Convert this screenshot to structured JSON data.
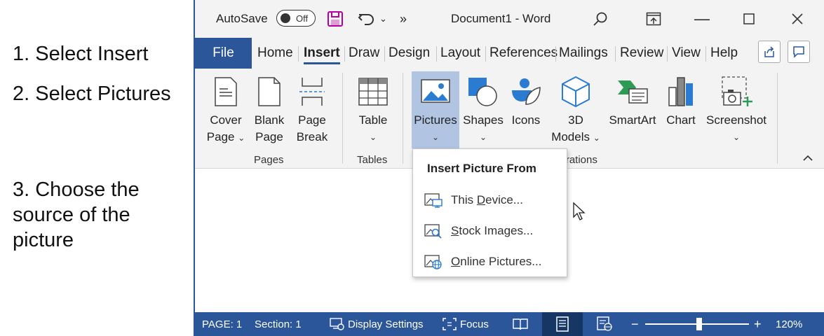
{
  "instructions": {
    "step1": "1. Select Insert",
    "step2": "2. Select Pictures",
    "step3": "3. Choose the source of the picture"
  },
  "titlebar": {
    "autosave_label": "AutoSave",
    "autosave_state": "Off",
    "document_title": "Document1  -  Word"
  },
  "tabs": {
    "file": "File",
    "items": [
      "Home",
      "Insert",
      "Draw",
      "Design",
      "Layout",
      "References",
      "Mailings",
      "Review",
      "View",
      "Help"
    ],
    "active": "Insert"
  },
  "ribbon": {
    "pages": {
      "cover_page": [
        "Cover",
        "Page"
      ],
      "blank_page": [
        "Blank",
        "Page"
      ],
      "page_break": [
        "Page",
        "Break"
      ],
      "group": "Pages"
    },
    "tables": {
      "table": "Table",
      "group": "Tables"
    },
    "illustrations": {
      "pictures": "Pictures",
      "shapes": "Shapes",
      "icons": "Icons",
      "models_3d": [
        "3D",
        "Models"
      ],
      "smartart": "SmartArt",
      "chart": "Chart",
      "screenshot": "Screenshot",
      "group": "Illustrations"
    }
  },
  "dropdown": {
    "title": "Insert Picture From",
    "items": [
      {
        "pre": "This ",
        "key": "D",
        "post": "evice..."
      },
      {
        "pre": "",
        "key": "S",
        "post": "tock Images..."
      },
      {
        "pre": "",
        "key": "O",
        "post": "nline Pictures..."
      }
    ]
  },
  "statusbar": {
    "page": "PAGE: 1",
    "section": "Section: 1",
    "display_settings": "Display Settings",
    "focus": "Focus",
    "zoom_minus": "−",
    "zoom_plus": "+",
    "zoom_level": "120%",
    "zoom_slider_fraction": 0.52
  },
  "colors": {
    "accent": "#2b579a",
    "selected": "#b1c5e2",
    "save_icon": "#b4009e"
  }
}
